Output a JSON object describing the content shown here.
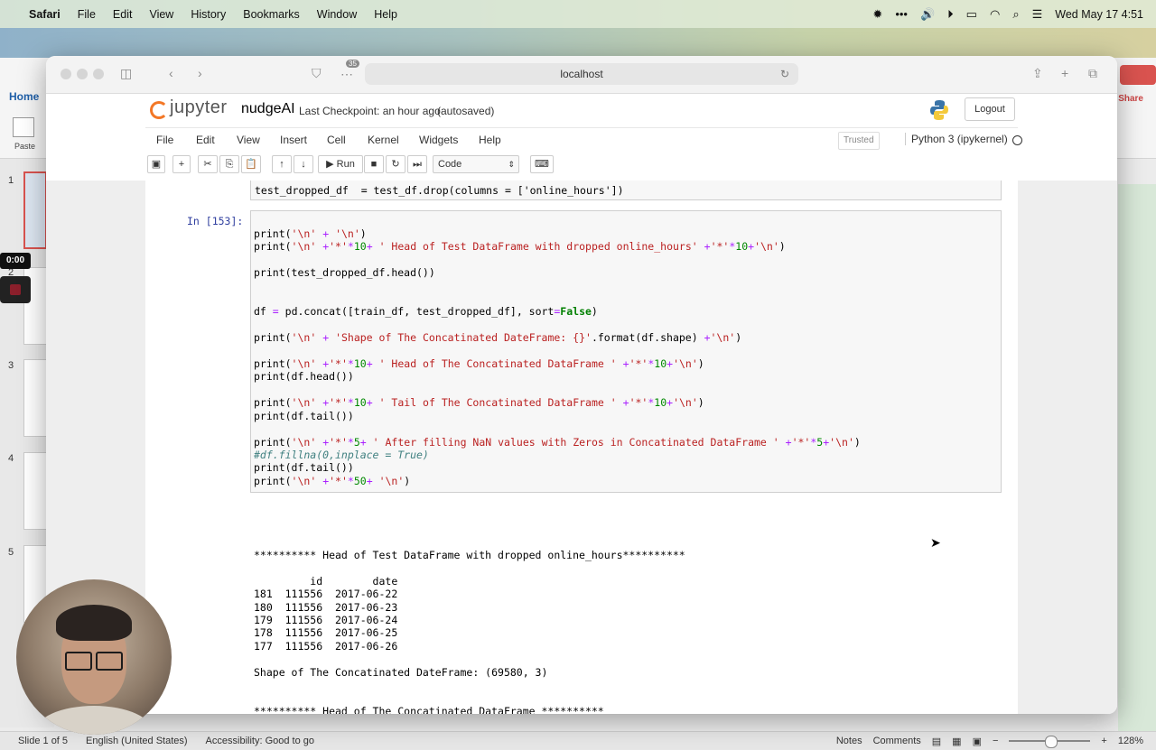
{
  "menubar": {
    "app": "Safari",
    "items": [
      "File",
      "Edit",
      "View",
      "History",
      "Bookmarks",
      "Window",
      "Help"
    ],
    "clock": "Wed May 17  4:51"
  },
  "ppt": {
    "tab_home": "Home",
    "paste": "Paste",
    "share": "Share",
    "slide_numbers": [
      "1",
      "2",
      "3",
      "4",
      "5"
    ],
    "timer": "0:00",
    "status": {
      "slide": "Slide 1 of 5",
      "language": "English (United States)",
      "accessibility": "Accessibility: Good to go",
      "notes": "Notes",
      "comments": "Comments",
      "zoom": "128%"
    }
  },
  "safari": {
    "url": "localhost",
    "tab_count": "35"
  },
  "jupyter": {
    "logo_text": "jupyter",
    "notebook_name": "nudgeAI",
    "checkpoint": "Last Checkpoint: an hour ago",
    "autosaved": "(autosaved)",
    "logout": "Logout",
    "menu": [
      "File",
      "Edit",
      "View",
      "Insert",
      "Cell",
      "Kernel",
      "Widgets",
      "Help"
    ],
    "trusted": "Trusted",
    "kernel": "Python 3 (ipykernel)",
    "toolbar": {
      "run": "Run",
      "cell_type": "Code"
    },
    "prompt": "In [153]:"
  },
  "cells": {
    "prev_tail": "test_dropped_df  = test_df.drop(columns = ['online_hours'])",
    "code_lines": [
      "print('\\n' + '\\n')",
      "print('\\n' +'*'*10+ ' Head of Test DataFrame with dropped online_hours' +'*'*10+'\\n')",
      "",
      "print(test_dropped_df.head())",
      "",
      "",
      "df = pd.concat([train_df, test_dropped_df], sort=False)",
      "",
      "print('\\n' + 'Shape of The Concatinated DateFrame: {}'.format(df.shape) +'\\n')",
      "",
      "print('\\n' +'*'*10+ ' Head of The Concatinated DataFrame ' +'*'*10+'\\n')",
      "print(df.head())",
      "",
      "print('\\n' +'*'*10+ ' Tail of The Concatinated DataFrame ' +'*'*10+'\\n')",
      "print(df.tail())",
      "",
      "print('\\n' +'*'*5+ ' After filling NaN values with Zeros in Concatinated DataFrame ' +'*'*5+'\\n')",
      "#df.fillna(0,inplace = True)",
      "print(df.tail())",
      "print('\\n' +'*'*50+ '\\n')"
    ],
    "output_lines": [
      "********** Head of Test DataFrame with dropped online_hours**********",
      "",
      "         id        date",
      "181  111556  2017-06-22",
      "180  111556  2017-06-23",
      "179  111556  2017-06-24",
      "178  111556  2017-06-25",
      "177  111556  2017-06-26",
      "",
      "Shape of The Concatinated DateFrame: (69580, 3)",
      "",
      "",
      "********** Head of The Concatinated DataFrame **********"
    ]
  },
  "colors": {
    "jupyter_orange": "#f37726",
    "prompt_blue": "#303f9f",
    "string_red": "#ba2121",
    "keyword_green": "#008000",
    "comment_teal": "#408080"
  }
}
